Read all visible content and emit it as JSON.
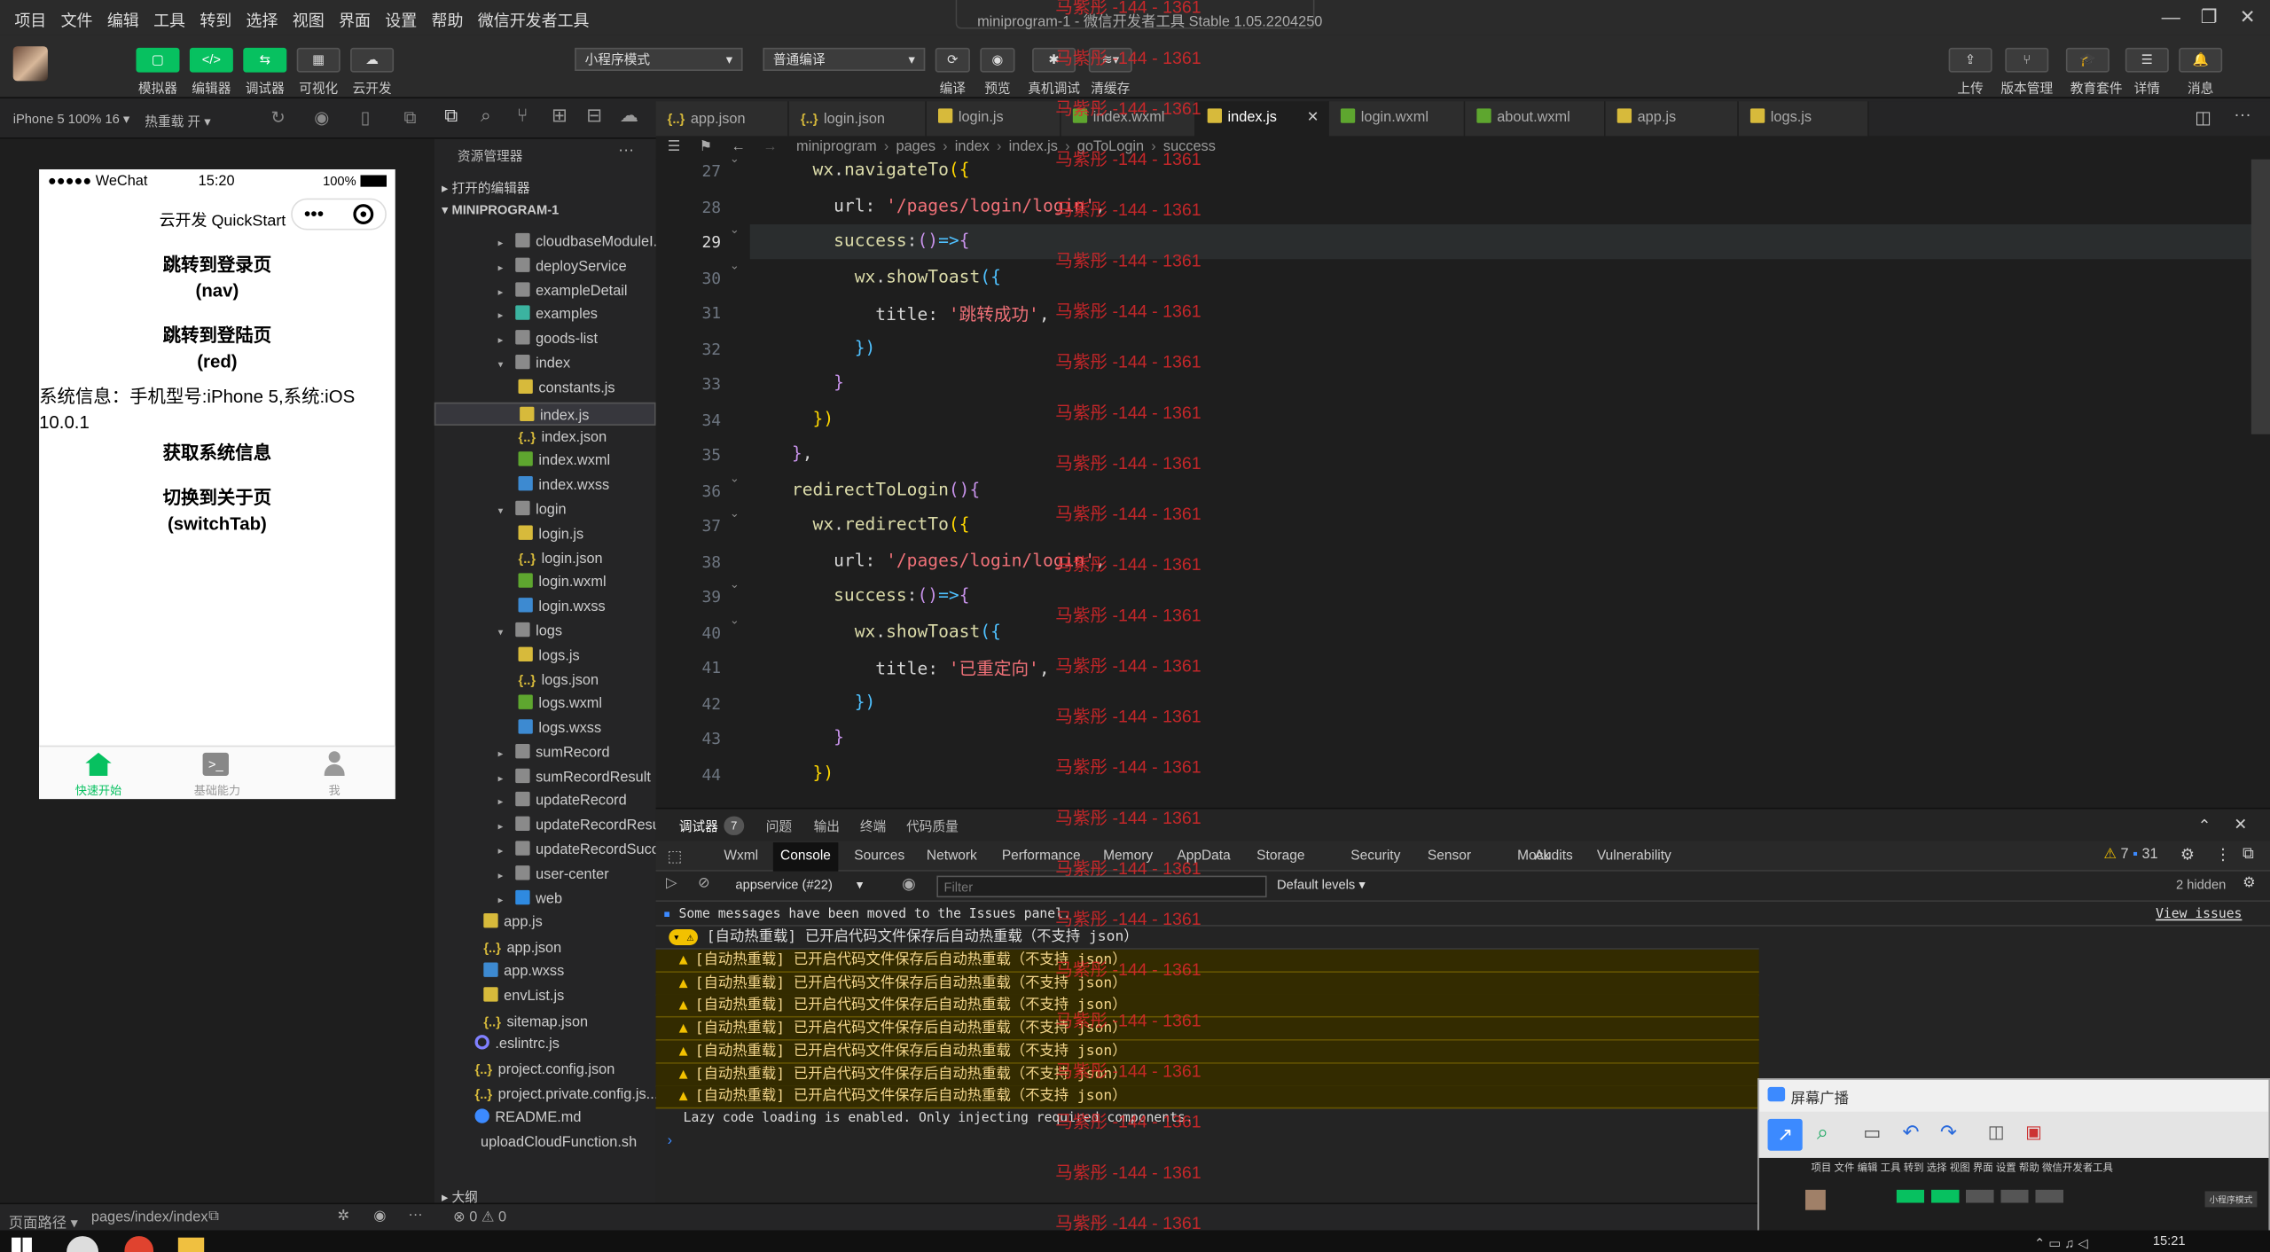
{
  "menu": [
    "项目",
    "文件",
    "编辑",
    "工具",
    "转到",
    "选择",
    "视图",
    "界面",
    "设置",
    "帮助",
    "微信开发者工具"
  ],
  "window_title": "miniprogram-1 - 微信开发者工具 Stable 1.05.2204250",
  "toolbar": {
    "left_buttons": [
      {
        "label": "模拟器",
        "glyph": "▢"
      },
      {
        "label": "编辑器",
        "glyph": "</>"
      },
      {
        "label": "调试器",
        "glyph": "⇆"
      },
      {
        "label": "可视化",
        "glyph": "▦"
      },
      {
        "label": "云开发",
        "glyph": "☁"
      }
    ],
    "mode_select": "小程序模式",
    "compile_select": "普通编译",
    "mid_buttons": [
      "编译",
      "预览",
      "真机调试",
      "清缓存"
    ],
    "right_buttons": [
      "上传",
      "版本管理",
      "教育套件",
      "详情",
      "消息"
    ]
  },
  "subbar": {
    "device": "iPhone 5 100% 16 ▾",
    "hotreload": "热重载 开 ▾"
  },
  "phone": {
    "carrier": "●●●●● WeChat",
    "time": "15:20",
    "battery": "100%",
    "nav_title": "云开发 QuickStart",
    "items": [
      "跳转到登录页\n(nav)",
      "跳转到登陆页\n(red)",
      "系统信息：手机型号:iPhone 5,系统:iOS 10.0.1",
      "获取系统信息",
      "切换到关于页\n(switchTab)"
    ],
    "tabbar": [
      "快速开始",
      "基础能力",
      "我"
    ]
  },
  "explorer": {
    "title": "资源管理器",
    "open_editors": "打开的编辑器",
    "project": "MINIPROGRAM-1",
    "rows": [
      {
        "t": "cloudbaseModuleI...",
        "k": "folder",
        "d": 2
      },
      {
        "t": "deployService",
        "k": "folder",
        "d": 2
      },
      {
        "t": "exampleDetail",
        "k": "folder",
        "d": 2
      },
      {
        "t": "examples",
        "k": "folder",
        "d": 2
      },
      {
        "t": "goods-list",
        "k": "folder",
        "d": 2
      },
      {
        "t": "index",
        "k": "folder",
        "d": 2,
        "open": true
      },
      {
        "t": "constants.js",
        "k": "js",
        "d": 3
      },
      {
        "t": "index.js",
        "k": "js",
        "d": 3,
        "sel": true
      },
      {
        "t": "index.json",
        "k": "json",
        "d": 3
      },
      {
        "t": "index.wxml",
        "k": "wxml",
        "d": 3
      },
      {
        "t": "index.wxss",
        "k": "wxss",
        "d": 3
      },
      {
        "t": "login",
        "k": "folder",
        "d": 2,
        "open": true
      },
      {
        "t": "login.js",
        "k": "js",
        "d": 3
      },
      {
        "t": "login.json",
        "k": "json",
        "d": 3
      },
      {
        "t": "login.wxml",
        "k": "wxml",
        "d": 3
      },
      {
        "t": "login.wxss",
        "k": "wxss",
        "d": 3
      },
      {
        "t": "logs",
        "k": "folder",
        "d": 2,
        "open": true
      },
      {
        "t": "logs.js",
        "k": "js",
        "d": 3
      },
      {
        "t": "logs.json",
        "k": "json",
        "d": 3
      },
      {
        "t": "logs.wxml",
        "k": "wxml",
        "d": 3
      },
      {
        "t": "logs.wxss",
        "k": "wxss",
        "d": 3
      },
      {
        "t": "sumRecord",
        "k": "folder",
        "d": 2
      },
      {
        "t": "sumRecordResult",
        "k": "folder",
        "d": 2
      },
      {
        "t": "updateRecord",
        "k": "folder",
        "d": 2
      },
      {
        "t": "updateRecordResult",
        "k": "folder",
        "d": 2
      },
      {
        "t": "updateRecordSuccess",
        "k": "folder",
        "d": 2
      },
      {
        "t": "user-center",
        "k": "folder",
        "d": 2
      },
      {
        "t": "web",
        "k": "folder",
        "d": 2
      },
      {
        "t": "app.js",
        "k": "js",
        "d": 1
      },
      {
        "t": "app.json",
        "k": "json",
        "d": 1
      },
      {
        "t": "app.wxss",
        "k": "wxss",
        "d": 1
      },
      {
        "t": "envList.js",
        "k": "js",
        "d": 1
      },
      {
        "t": "sitemap.json",
        "k": "json",
        "d": 1
      },
      {
        "t": ".eslintrc.js",
        "k": "dot",
        "d": 0
      },
      {
        "t": "project.config.json",
        "k": "json",
        "d": 0
      },
      {
        "t": "project.private.config.js...",
        "k": "json",
        "d": 0
      },
      {
        "t": "README.md",
        "k": "info",
        "d": 0
      },
      {
        "t": "uploadCloudFunction.sh",
        "k": "sh",
        "d": 0
      }
    ],
    "outline": "大纲"
  },
  "tabs": [
    {
      "t": "app.json",
      "k": "json"
    },
    {
      "t": "login.json",
      "k": "json"
    },
    {
      "t": "login.js",
      "k": "js"
    },
    {
      "t": "index.wxml",
      "k": "wxml"
    },
    {
      "t": "index.js",
      "k": "js",
      "active": true
    },
    {
      "t": "login.wxml",
      "k": "wxml"
    },
    {
      "t": "about.wxml",
      "k": "wxml"
    },
    {
      "t": "app.js",
      "k": "js"
    },
    {
      "t": "logs.js",
      "k": "js"
    }
  ],
  "breadcrumb": [
    "miniprogram",
    "pages",
    "index",
    "index.js",
    "goToLogin",
    "success"
  ],
  "code": [
    {
      "n": "27",
      "html": "      <span class='fn'>wx</span>.<span class='fn'>navigateTo</span><span class='ye'>({</span>"
    },
    {
      "n": "28",
      "html": "        url: <span class='st'>'/pages/login/login'</span>,"
    },
    {
      "n": "29",
      "html": "        <span class='fn'>success</span>:<span class='pn'>()</span><span class='kw'>=></span><span class='pn'>{</span>"
    },
    {
      "n": "30",
      "html": "          <span class='fn'>wx</span>.<span class='fn'>showToast</span><span class='kw'>({</span>"
    },
    {
      "n": "31",
      "html": "            title: <span class='st'>'跳转成功'</span>,"
    },
    {
      "n": "32",
      "html": "          <span class='kw'>})</span>"
    },
    {
      "n": "33",
      "html": "        <span class='pn'>}</span>"
    },
    {
      "n": "34",
      "html": "      <span class='ye'>})</span>"
    },
    {
      "n": "35",
      "html": "    <span class='pn'>}</span>,"
    },
    {
      "n": "36",
      "html": "    <span class='fn'>redirectToLogin</span><span class='pn'>(){</span>"
    },
    {
      "n": "37",
      "html": "      <span class='fn'>wx</span>.<span class='fn'>redirectTo</span><span class='ye'>({</span>"
    },
    {
      "n": "38",
      "html": "        url: <span class='st'>'/pages/login/login'</span>,"
    },
    {
      "n": "39",
      "html": "        <span class='fn'>success</span>:<span class='pn'>()</span><span class='kw'>=></span><span class='pn'>{</span>"
    },
    {
      "n": "40",
      "html": "          <span class='fn'>wx</span>.<span class='fn'>showToast</span><span class='kw'>({</span>"
    },
    {
      "n": "41",
      "html": "            title: <span class='st'>'已重定向'</span>,"
    },
    {
      "n": "42",
      "html": "          <span class='kw'>})</span>"
    },
    {
      "n": "43",
      "html": "        <span class='pn'>}</span>"
    },
    {
      "n": "44",
      "html": "      <span class='ye'>})</span>"
    }
  ],
  "watermark": "马紫彤 -144 - 1361",
  "console": {
    "tabs": [
      "调试器",
      "问题",
      "输出",
      "终端",
      "代码质量"
    ],
    "badge": "7",
    "devtabs": [
      "Wxml",
      "Console",
      "Sources",
      "Network",
      "Performance",
      "Memory",
      "AppData",
      "Storage",
      "Security",
      "Sensor",
      "Mock",
      "Audits",
      "Vulnerability"
    ],
    "warn_count": "7",
    "info_count": "31",
    "context": "appservice (#22)",
    "filter_placeholder": "Filter",
    "levels": "Default levels ▾",
    "hidden": "2 hidden",
    "info_msg": "Some messages have been moved to the Issues panel.",
    "view_issues": "View issues",
    "group_msg": "[自动热重载] 已开启代码文件保存后自动热重载（不支持 json）",
    "warn_msg": "[自动热重载] 已开启代码文件保存后自动热重载（不支持 json）",
    "lazy_msg": "Lazy code loading is enabled. Only injecting required components."
  },
  "status": {
    "path_label": "页面路径 ▾",
    "path": "pages/index/index",
    "errors": "⊗ 0 ⚠ 0"
  },
  "cast": {
    "title": "屏幕广播"
  },
  "clock": "15:21"
}
